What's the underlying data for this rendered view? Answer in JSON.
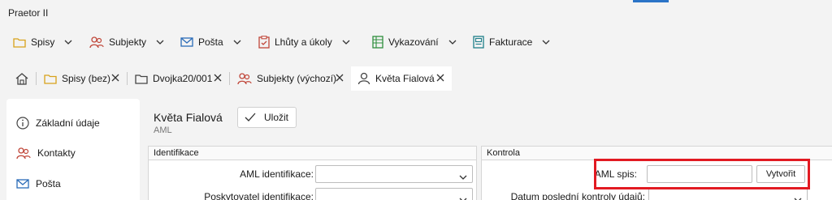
{
  "app": {
    "title": "Praetor II"
  },
  "menu": [
    {
      "label": "Spisy",
      "icon": "folder-icon"
    },
    {
      "label": "Subjekty",
      "icon": "people-icon"
    },
    {
      "label": "Pošta",
      "icon": "mail-icon"
    },
    {
      "label": "Lhůty a úkoly",
      "icon": "clipboard-icon"
    },
    {
      "label": "Vykazování",
      "icon": "spreadsheet-icon"
    },
    {
      "label": "Fakturace",
      "icon": "invoice-icon"
    }
  ],
  "tabs": [
    {
      "label": "Spisy (bez)",
      "icon": "folder-icon"
    },
    {
      "label": "Dvojka20/001",
      "icon": "document-folder-icon"
    },
    {
      "label": "Subjekty (výchozí)",
      "icon": "people-icon"
    },
    {
      "label": "Květa Fialová",
      "icon": "person-icon",
      "active": true
    }
  ],
  "sidebar": [
    {
      "label": "Základní údaje",
      "icon": "info-icon"
    },
    {
      "label": "Kontakty",
      "icon": "people-icon"
    },
    {
      "label": "Pošta",
      "icon": "mail-icon"
    }
  ],
  "header": {
    "name": "Květa Fialová",
    "subtitle": "AML",
    "save_label": "Uložit"
  },
  "identifikace": {
    "title": "Identifikace",
    "aml_identifikace_label": "AML identifikace:",
    "aml_identifikace_value": "",
    "poskytovatel_label": "Poskytovatel identifikace:",
    "poskytovatel_value": ""
  },
  "kontrola": {
    "title": "Kontrola",
    "aml_spis_label": "AML spis:",
    "aml_spis_value": "",
    "create_label": "Vytvořit",
    "datum_label": "Datum poslední kontroly údajů:",
    "datum_value": ""
  },
  "colors": {
    "highlight": "#e21a22",
    "accent": "#2b74c7"
  }
}
